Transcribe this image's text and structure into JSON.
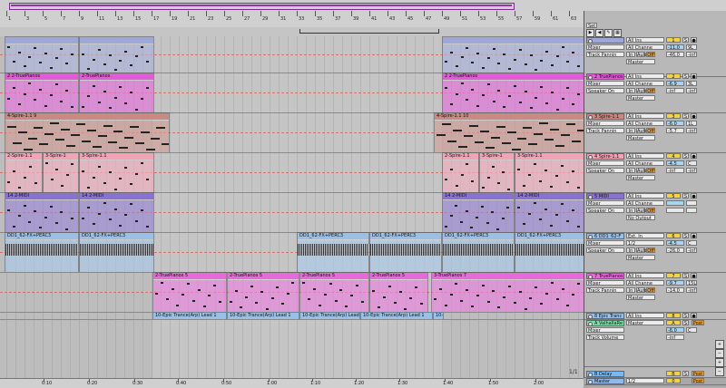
{
  "ruler": {
    "bars": [
      "1",
      "3",
      "5",
      "7",
      "9",
      "11",
      "13",
      "15",
      "17",
      "19",
      "21",
      "23",
      "25",
      "27",
      "29",
      "31",
      "33",
      "35",
      "37",
      "39",
      "41",
      "43",
      "45",
      "47",
      "49",
      "51",
      "53",
      "55",
      "57",
      "59",
      "61",
      "63"
    ]
  },
  "timebar": {
    "times": [
      "0:10",
      "0:20",
      "0:30",
      "0:40",
      "0:50",
      "1:00",
      "1:10",
      "1:20",
      "1:30",
      "1:40",
      "1:50",
      "2:00"
    ]
  },
  "page_indicator": "1/1",
  "controls": {
    "set": "Set",
    "top_buttons": [
      "▶",
      "◀",
      "✎",
      "▦"
    ]
  },
  "colors": {
    "track1": "#9ea8d8",
    "track2": "#e35ad8",
    "track3": "#c88a82",
    "track4": "#f2a4b6",
    "track5": "#8a72d0",
    "track6": "#9ac0e8",
    "track7": "#e66bd8",
    "return_a": "#7de0a8",
    "return_b": "#7ab8f0",
    "master": "#90b8e8",
    "orange": "#f0a030",
    "accent_on": "#f3d346"
  },
  "tracks": [
    {
      "clips": [
        {
          "label": ""
        },
        {
          "label": ""
        },
        {
          "label": ""
        }
      ],
      "mixer": {
        "name": "",
        "input": "All Ins",
        "channel": "All Channe",
        "monitor": [
          "In",
          "Auto",
          "Off"
        ],
        "output": "Mixer",
        "sub_output": "Track Pannin",
        "dest": "Master",
        "number": "1",
        "volume": "-11.0",
        "pan": "9L",
        "peak": "-46.0",
        "peak2": "-inf"
      }
    },
    {
      "clips": [
        {
          "label": "2 2-TruePianos"
        },
        {
          "label": "2-TruePianos"
        },
        {
          "label": "2 2-TruePianos"
        }
      ],
      "mixer": {
        "name": "2 TruePianos",
        "input": "All Ins",
        "channel": "All Channe",
        "monitor": [
          "In",
          "Auto",
          "Off"
        ],
        "output": "Mixer",
        "sub_output": "Speaker On",
        "dest": "Master",
        "number": "2",
        "volume": "-6.9",
        "pan": "3L",
        "peak": "-inf",
        "peak2": "-inf"
      }
    },
    {
      "clips": [
        {
          "label": "4-Spire-1.1 9"
        },
        {
          "label": "4-Spire-1.1 10"
        }
      ],
      "mixer": {
        "name": "3 Spire-1.1",
        "input": "All Ins",
        "channel": "All Channe",
        "monitor": [
          "In",
          "Auto",
          "Off"
        ],
        "output": "Mixer",
        "sub_output": "Track Pannin",
        "dest": "Master",
        "number": "3",
        "volume": "-6.0",
        "pan": "1L",
        "peak": "-5.7",
        "peak2": "-inf"
      }
    },
    {
      "clips": [
        {
          "label": "2-Spire-1.1"
        },
        {
          "label": "3-Spire-1"
        },
        {
          "label": "3-Spire-1.1"
        },
        {
          "label": "2-Spire-1.1"
        },
        {
          "label": "3-Spire-1"
        },
        {
          "label": "3-Spire-1.1"
        }
      ],
      "mixer": {
        "name": "4 Spire-1.1",
        "input": "All Ins",
        "channel": "All Channe",
        "monitor": [
          "In",
          "Auto",
          "Off"
        ],
        "output": "Mixer",
        "sub_output": "Speaker On",
        "dest": "Master",
        "number": "4",
        "volume": "-4.5",
        "pan": "C",
        "peak": "-inf",
        "peak2": "-inf"
      }
    },
    {
      "clips": [
        {
          "label": "14 2-MIDI"
        },
        {
          "label": "14 2-MIDI"
        },
        {
          "label": "14 2-MIDI"
        },
        {
          "label": "14 2-MIDI"
        }
      ],
      "mixer": {
        "name": "5 MIDI",
        "input": "All Ins",
        "channel": "All Channe",
        "monitor": [
          "In",
          "Auto",
          "Off"
        ],
        "output": "Mixer",
        "sub_output": "Speaker On",
        "dest": "No Output",
        "number": "5",
        "volume": "",
        "pan": "",
        "peak": "",
        "peak2": ""
      }
    },
    {
      "clips": [
        {
          "label": "DD1_62-FX+PERC3"
        },
        {
          "label": "DD1_62-FX+PERC3"
        },
        {
          "label": "DD1_62-FX+PERC3"
        },
        {
          "label": "DD1_62-FX+PERC3"
        },
        {
          "label": "DD1_62-FX+PERC3"
        },
        {
          "label": "DD1_62-FX+PERC3"
        }
      ],
      "mixer": {
        "name": "6 DD1_62-F",
        "input": "Ext. In",
        "channel": "1/2",
        "monitor": [
          "In",
          "Auto",
          "Off"
        ],
        "output": "Mixer",
        "sub_output": "Speaker On",
        "dest": "Master",
        "number": "6",
        "volume": "-4.5",
        "pan": "C",
        "peak": "-26.0",
        "peak2": "-inf"
      }
    },
    {
      "clips": [
        {
          "label": "2-TruePianos 5"
        },
        {
          "label": "2-TruePianos 5"
        },
        {
          "label": "2-TruePianos 5"
        },
        {
          "label": "2-TruePianos 5"
        },
        {
          "label": "3-TruePianos 7"
        }
      ],
      "mixer": {
        "name": "7 TruePianos",
        "input": "All Ins",
        "channel": "All Channe",
        "monitor": [
          "In",
          "Auto",
          "Off"
        ],
        "output": "Mixer",
        "sub_output": "Track Pannin",
        "dest": "Master",
        "number": "7",
        "volume": "-9.7",
        "pan": "15L",
        "peak": "-14.0",
        "peak2": "-inf"
      }
    },
    {
      "clips": [
        {
          "label": "10-Epic Trance(Arp) Lead 1"
        },
        {
          "label": "10-Epic Trance(Arp) Lead 1"
        },
        {
          "label": "10-Epic Trance(Arp) Lead 1"
        },
        {
          "label": "10-Epic Trance(Arp) Lead 1"
        },
        {
          "label": "10-Epic Trance(Arp) Lead 1"
        }
      ],
      "mixer": {
        "name": "8 Epic Tranc",
        "input": "All Ins",
        "channel": "All Channe",
        "monitor": [
          "In",
          "Auto",
          "Off"
        ],
        "output": "Mixer",
        "sub_output": "",
        "dest": "Master",
        "number": "8",
        "volume": "",
        "pan": "",
        "peak": "",
        "peak2": ""
      }
    }
  ],
  "returns": [
    {
      "name": "A ValhallaRe",
      "output": "Master",
      "sub": "Mixer",
      "sub2": "Track Volume",
      "number": "A",
      "volume": "-6.0",
      "pan": "C",
      "peak": "-inf",
      "post": "Post"
    },
    {
      "name": "B Delay",
      "output": "",
      "number": "B",
      "volume": "",
      "pan": "",
      "peak": "",
      "post": "Post"
    }
  ],
  "master": {
    "name": "Master",
    "output": "1/2",
    "number": "0",
    "volume": "",
    "pan": "",
    "post": "Post"
  }
}
